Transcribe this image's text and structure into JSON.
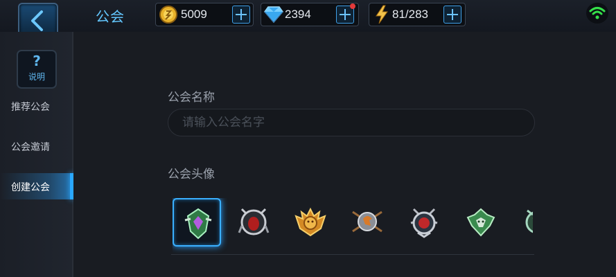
{
  "header": {
    "title": "公会",
    "gold": "5009",
    "diamonds": "2394",
    "energy": "81/283"
  },
  "sidebar": {
    "help_label": "说明",
    "help_symbol": "?",
    "items": [
      {
        "label": "推荐公会"
      },
      {
        "label": "公会邀请"
      },
      {
        "label": "创建公会",
        "active": true
      }
    ]
  },
  "main": {
    "name_label": "公会名称",
    "name_placeholder": "请输入公会名字",
    "name_value": "",
    "avatar_label": "公会头像",
    "avatars": [
      {
        "icon": "green-crest-icon",
        "selected": true
      },
      {
        "icon": "dark-skull-crest-icon"
      },
      {
        "icon": "golden-lion-crest-icon"
      },
      {
        "icon": "eagle-axes-crest-icon"
      },
      {
        "icon": "red-spider-crest-icon"
      },
      {
        "icon": "green-dragon-crest-icon"
      },
      {
        "icon": "serpent-crest-icon"
      }
    ]
  },
  "colors": {
    "accent": "#3ab0ff",
    "title": "#63c7ff",
    "notification": "#e43a3a",
    "wifi": "#35e04a"
  }
}
